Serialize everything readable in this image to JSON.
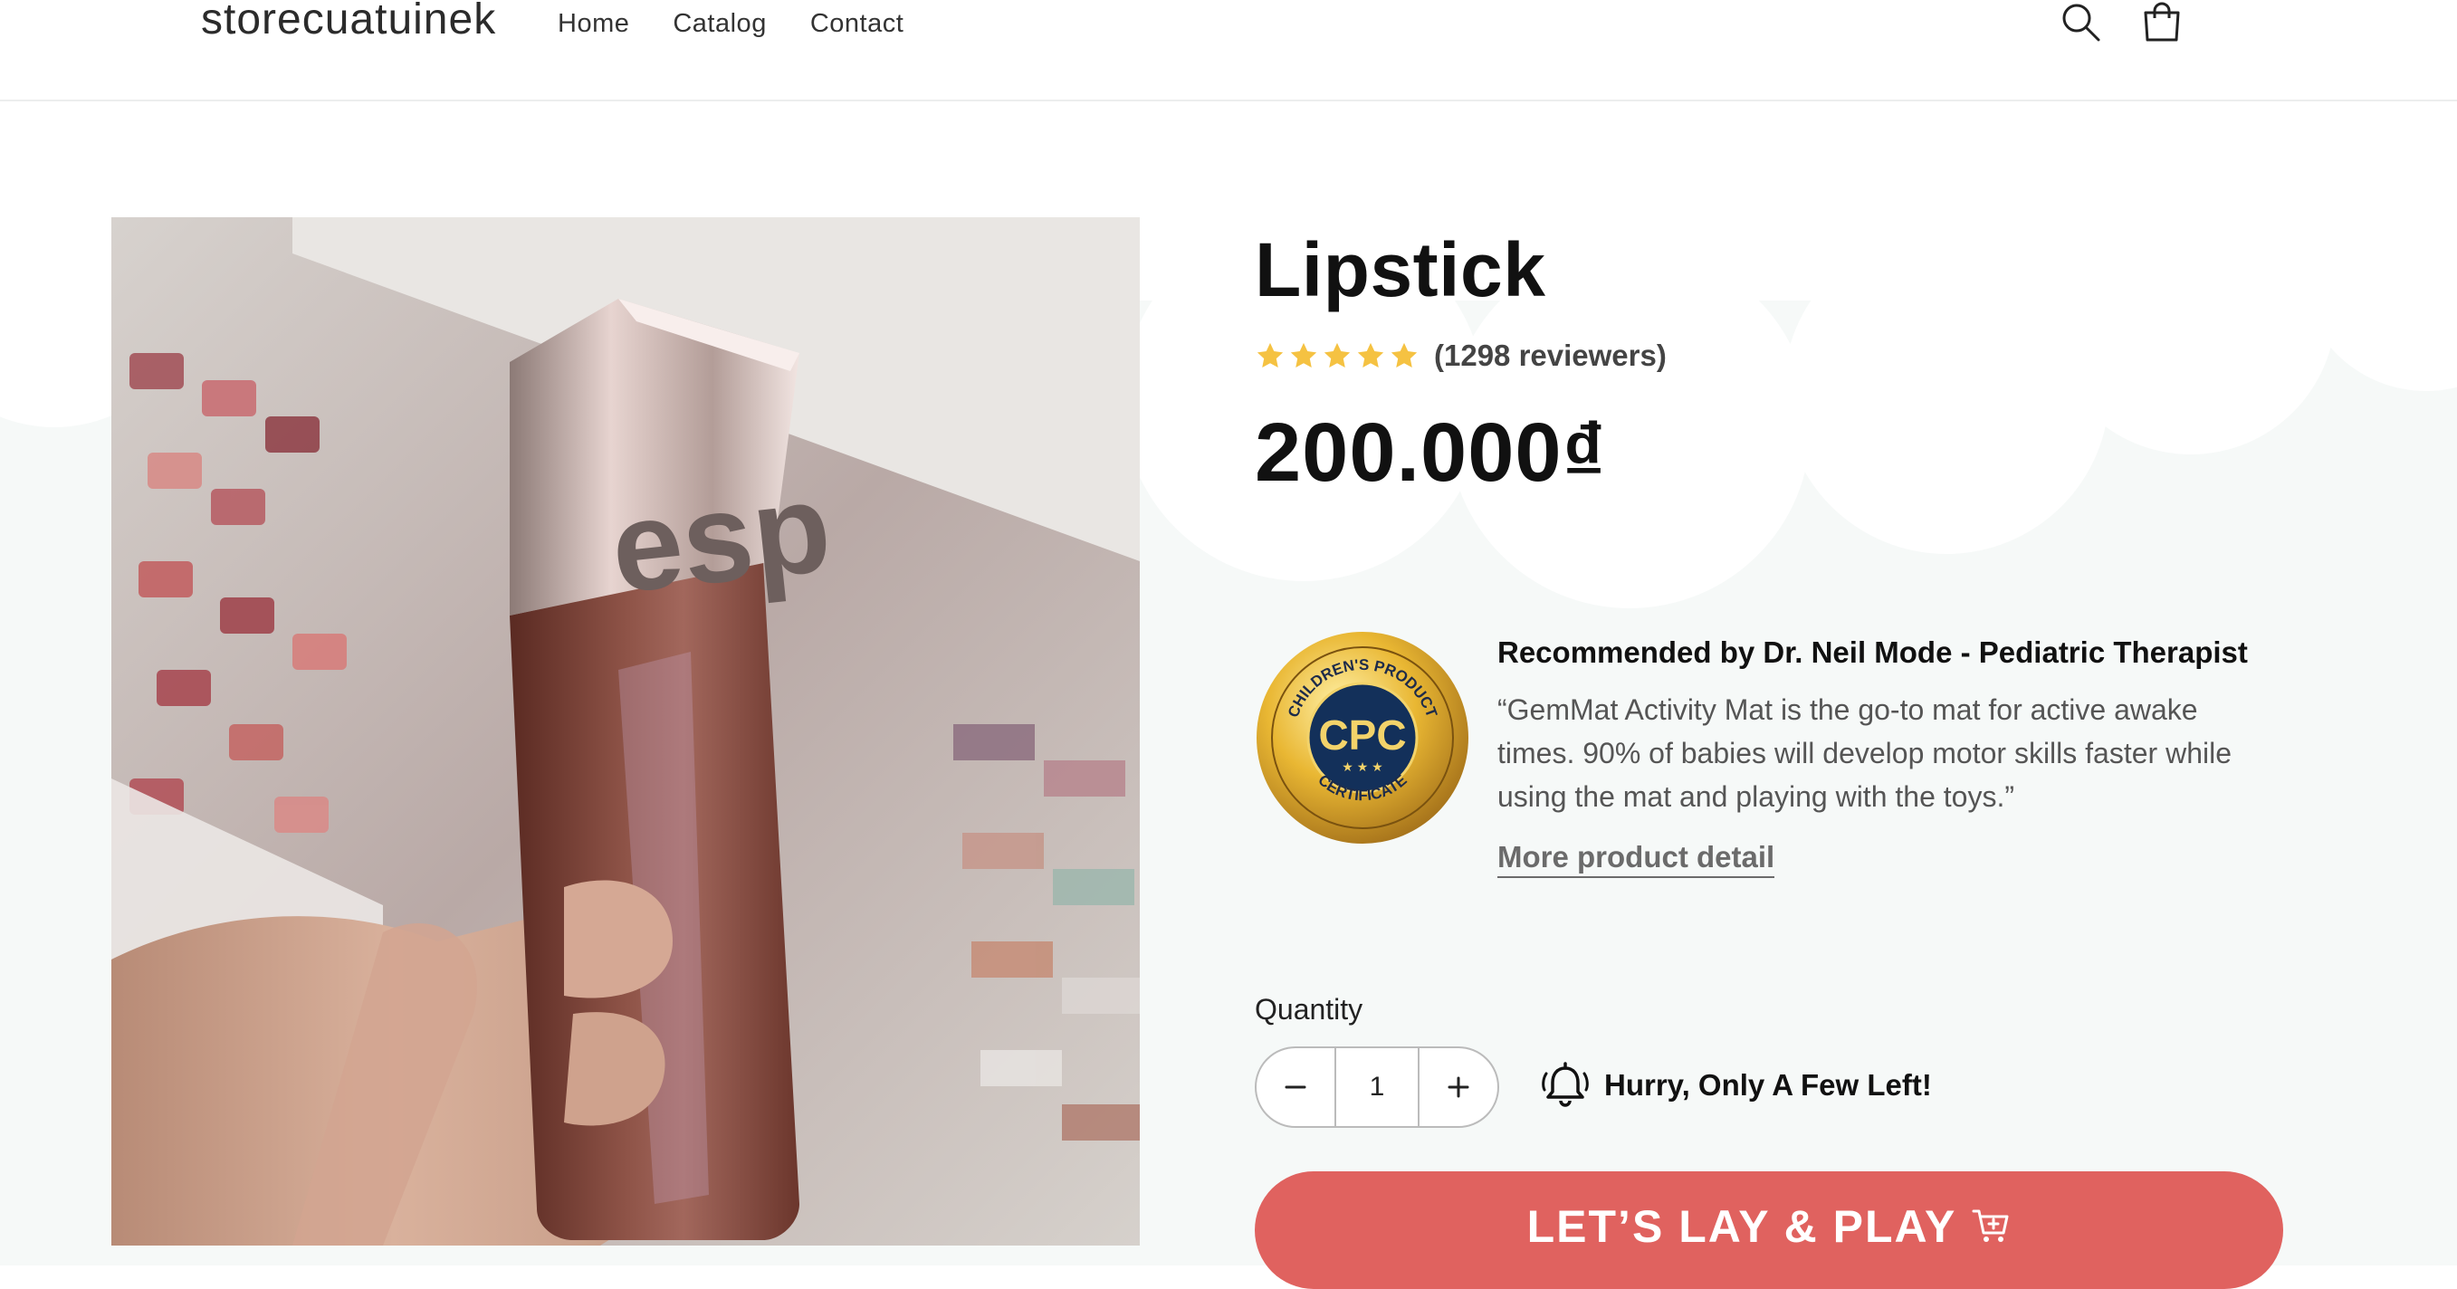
{
  "header": {
    "logo": "storecuatuinek",
    "nav": [
      "Home",
      "Catalog",
      "Contact"
    ],
    "icons": [
      "search-icon",
      "cart-icon"
    ]
  },
  "product": {
    "title": "Lipstick",
    "rating_stars": 5,
    "reviews_text": "(1298 reviewers)",
    "price": "200.000₫",
    "image_description": "esp",
    "recommendation": {
      "badge_top_text": "CHILDREN'S PRODUCT",
      "badge_center_text": "CPC",
      "badge_bottom_text": "CERTIFICATE",
      "title": "Recommended by Dr. Neil Mode - Pediatric Therapist",
      "quote": "“GemMat Activity Mat is the go-to mat for active awake times. 90% of babies will develop motor skills faster while using the mat and playing with the toys.”",
      "link": "More product detail"
    },
    "quantity_label": "Quantity",
    "quantity_value": "1",
    "stock_notice": "Hurry, Only A Few Left!",
    "cta_label": "LET’S LAY & PLAY"
  },
  "colors": {
    "accent": "#e0625f",
    "star": "#f5c242",
    "background": "#f6f9f8"
  }
}
